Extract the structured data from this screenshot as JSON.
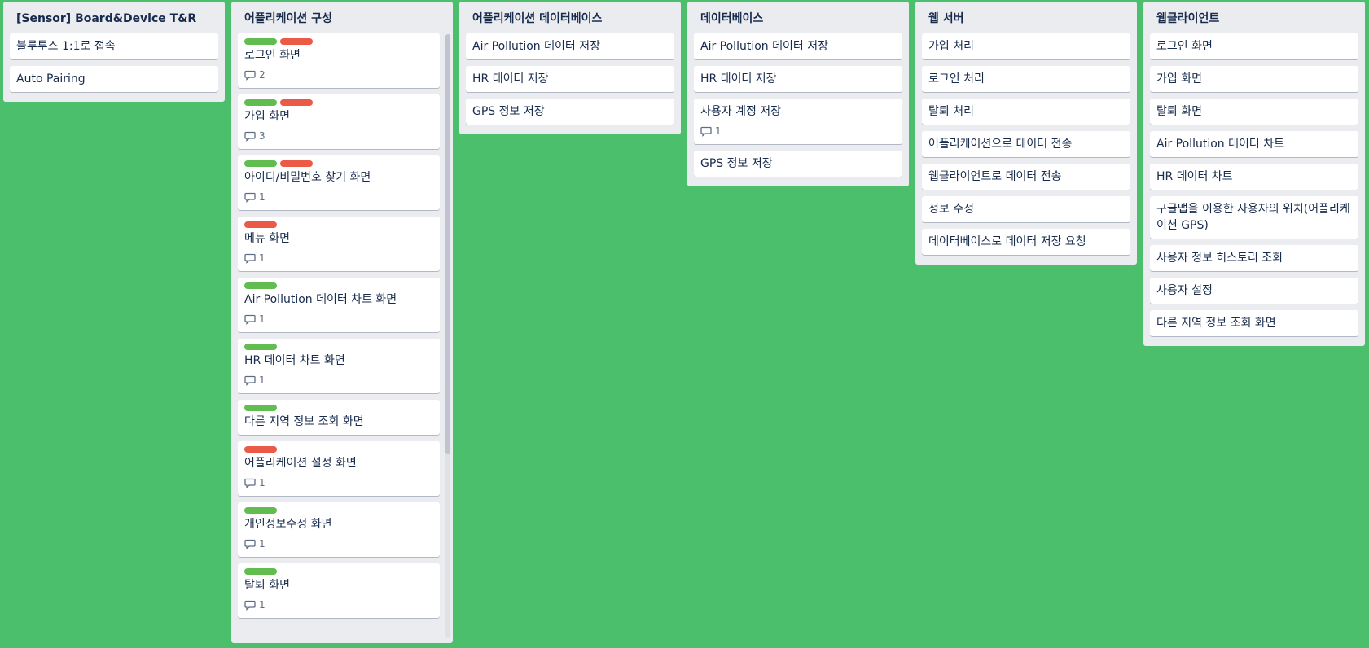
{
  "lists": [
    {
      "title": "[Sensor] Board&Device T&R",
      "cards": [
        {
          "title": "블루투스 1:1로 접속"
        },
        {
          "title": "Auto Pairing"
        }
      ]
    },
    {
      "title": "어플리케이션 구성",
      "cards": [
        {
          "title": "로그인 화면",
          "labels": [
            "green",
            "red"
          ],
          "comments": "2"
        },
        {
          "title": "가입 화면",
          "labels": [
            "green",
            "red"
          ],
          "comments": "3"
        },
        {
          "title": "아이디/비밀번호 찾기 화면",
          "labels": [
            "green",
            "red"
          ],
          "comments": "1"
        },
        {
          "title": "메뉴 화면",
          "labels": [
            "red"
          ],
          "comments": "1"
        },
        {
          "title": "Air Pollution 데이터 차트 화면",
          "labels": [
            "green"
          ],
          "comments": "1"
        },
        {
          "title": "HR 데이터 차트 화면",
          "labels": [
            "green"
          ],
          "comments": "1"
        },
        {
          "title": "다른 지역 정보 조회 화면",
          "labels": [
            "green"
          ]
        },
        {
          "title": "어플리케이션 설정 화면",
          "labels": [
            "red"
          ],
          "comments": "1"
        },
        {
          "title": "개인정보수정 화면",
          "labels": [
            "green"
          ],
          "comments": "1"
        },
        {
          "title": "탈퇴 화면",
          "labels": [
            "green"
          ],
          "comments": "1"
        }
      ]
    },
    {
      "title": "어플리케이션 데이터베이스",
      "cards": [
        {
          "title": "Air Pollution 데이터 저장"
        },
        {
          "title": "HR 데이터 저장"
        },
        {
          "title": "GPS 정보 저장"
        }
      ]
    },
    {
      "title": "데이터베이스",
      "cards": [
        {
          "title": "Air Pollution 데이터 저장"
        },
        {
          "title": "HR 데이터 저장"
        },
        {
          "title": "사용자 계정 저장",
          "comments": "1"
        },
        {
          "title": "GPS 정보 저장"
        }
      ]
    },
    {
      "title": "웹 서버",
      "cards": [
        {
          "title": "가입 처리"
        },
        {
          "title": "로그인 처리"
        },
        {
          "title": "탈퇴 처리"
        },
        {
          "title": "어플리케이션으로 데이터 전송"
        },
        {
          "title": "웹클라이언트로 데이터 전송"
        },
        {
          "title": "정보 수정"
        },
        {
          "title": "데이터베이스로 데이터 저장 요청"
        }
      ]
    },
    {
      "title": "웹클라이언트",
      "cards": [
        {
          "title": "로그인 화면"
        },
        {
          "title": "가입 화면"
        },
        {
          "title": "탈퇴 화면"
        },
        {
          "title": "Air Pollution 데이터 차트"
        },
        {
          "title": "HR 데이터 차트"
        },
        {
          "title": "구글맵을 이용한 사용자의 위치(어플리케이션 GPS)"
        },
        {
          "title": "사용자 정보 히스토리 조회"
        },
        {
          "title": "사용자 설정"
        },
        {
          "title": "다른 지역 정보 조회 화면"
        }
      ]
    }
  ],
  "colors": {
    "background": "#4bbf6b",
    "list_bg": "#ebecf0",
    "label_green": "#61bd4f",
    "label_red": "#eb5a46"
  },
  "icons": {
    "comment": "comment-icon"
  }
}
